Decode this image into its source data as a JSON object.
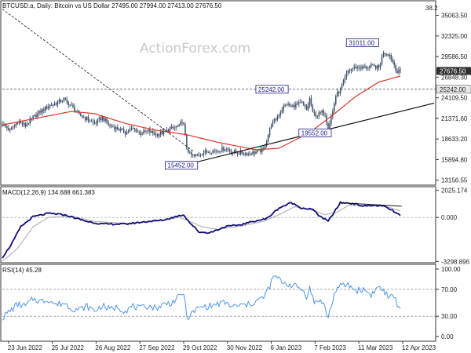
{
  "header": {
    "price_title": "BTCUSD.a, Daily:  Bitcoin vs US Dollar  27495.00  27994.00  27413.00  27676.50",
    "macd_title": "MACD(12,26,9)  134.688 661.383",
    "rsi_title": "RSI(14) 45.28",
    "watermark": "ActionForex.com"
  },
  "colors": {
    "candle": "#3d4f66",
    "ma": "#e0332a",
    "macd": "#0e0e7a",
    "signal": "#b4b4b4",
    "rsi": "#4f95e8",
    "box_border": "#1c1c8a",
    "trend": "#111111"
  },
  "chart_data": [
    {
      "type": "line",
      "name": "price",
      "y_axis_ticks": [
        "35063.50",
        "32325.00",
        "29586.50",
        "26848.30",
        "24109.50",
        "21371.60",
        "18633.20",
        "15894.80",
        "13156.55"
      ],
      "corner_value": "38.2",
      "ylim": [
        12500,
        37000
      ],
      "current_price_label": "27676.50",
      "level_label": "25242.00",
      "level": 25242,
      "x_ticks": [
        "23 Jun 2022",
        "25 Jul 2022",
        "26 Aug 2022",
        "27 Sep 2022",
        "29 Oct 2022",
        "30 Nov 2022",
        "6 Jan 2023",
        "7 Feb 2023",
        "11 Mar 2023",
        "12 Apr 2023"
      ],
      "annotations": [
        {
          "label": "31011.00",
          "index": 248,
          "value": 31011
        },
        {
          "label": "25242.00",
          "index": 185,
          "value": 25242
        },
        {
          "label": "19552.00",
          "index": 212,
          "value": 19552
        },
        {
          "label": "15452.00",
          "index": 124,
          "value": 15452
        }
      ],
      "anchors": [
        [
          0,
          20600
        ],
        [
          5,
          19800
        ],
        [
          10,
          21000
        ],
        [
          15,
          20400
        ],
        [
          20,
          21500
        ],
        [
          25,
          22300
        ],
        [
          30,
          23000
        ],
        [
          35,
          23400
        ],
        [
          40,
          23900
        ],
        [
          45,
          23000
        ],
        [
          50,
          21800
        ],
        [
          55,
          21300
        ],
        [
          60,
          20700
        ],
        [
          65,
          21500
        ],
        [
          70,
          20400
        ],
        [
          75,
          20000
        ],
        [
          80,
          19500
        ],
        [
          85,
          20000
        ],
        [
          90,
          19400
        ],
        [
          95,
          19700
        ],
        [
          100,
          19200
        ],
        [
          105,
          19500
        ],
        [
          110,
          20000
        ],
        [
          115,
          20300
        ],
        [
          117,
          21000
        ],
        [
          118,
          20400
        ],
        [
          120,
          17500
        ],
        [
          122,
          16600
        ],
        [
          125,
          16300
        ],
        [
          130,
          16800
        ],
        [
          135,
          17000
        ],
        [
          140,
          17100
        ],
        [
          145,
          17400
        ],
        [
          150,
          16900
        ],
        [
          155,
          16800
        ],
        [
          160,
          16700
        ],
        [
          165,
          16900
        ],
        [
          170,
          17200
        ],
        [
          172,
          18500
        ],
        [
          175,
          20600
        ],
        [
          178,
          21300
        ],
        [
          182,
          22600
        ],
        [
          185,
          23300
        ],
        [
          188,
          22900
        ],
        [
          190,
          23100
        ],
        [
          195,
          23400
        ],
        [
          198,
          22500
        ],
        [
          200,
          24000
        ],
        [
          202,
          22000
        ],
        [
          205,
          21800
        ],
        [
          208,
          22200
        ],
        [
          210,
          22000
        ],
        [
          212,
          20000
        ],
        [
          213,
          20800
        ],
        [
          215,
          22300
        ],
        [
          217,
          24400
        ],
        [
          220,
          25200
        ],
        [
          225,
          27700
        ],
        [
          230,
          28200
        ],
        [
          235,
          28100
        ],
        [
          240,
          28300
        ],
        [
          245,
          28100
        ],
        [
          248,
          30200
        ],
        [
          252,
          29800
        ],
        [
          255,
          28500
        ],
        [
          257,
          27500
        ],
        [
          259,
          27676
        ]
      ],
      "ma_anchors": [
        [
          0,
          20500
        ],
        [
          25,
          21500
        ],
        [
          45,
          22300
        ],
        [
          60,
          22000
        ],
        [
          80,
          20700
        ],
        [
          100,
          19800
        ],
        [
          120,
          19200
        ],
        [
          140,
          18200
        ],
        [
          165,
          17200
        ],
        [
          180,
          17400
        ],
        [
          200,
          19500
        ],
        [
          215,
          21800
        ],
        [
          230,
          24300
        ],
        [
          245,
          26200
        ],
        [
          259,
          27000
        ]
      ],
      "trend_lines": [
        {
          "from": [
            0,
            35900
          ],
          "to": [
            125,
            16900
          ]
        },
        {
          "from": [
            124,
            15452
          ],
          "to": [
            281,
            23400
          ]
        }
      ],
      "xmax": 282
    },
    {
      "type": "line",
      "name": "MACD(12,26,9)",
      "y_axis_ticks": [
        "2025.174",
        "0.000",
        "-3298.896"
      ],
      "ylim": [
        -3400,
        2300
      ],
      "macd_anchors": [
        [
          0,
          -3000
        ],
        [
          6,
          -2000
        ],
        [
          12,
          -700
        ],
        [
          20,
          50
        ],
        [
          30,
          300
        ],
        [
          40,
          200
        ],
        [
          55,
          -300
        ],
        [
          65,
          -500
        ],
        [
          80,
          -500
        ],
        [
          95,
          -300
        ],
        [
          105,
          -200
        ],
        [
          114,
          100
        ],
        [
          118,
          200
        ],
        [
          122,
          -400
        ],
        [
          128,
          -1100
        ],
        [
          135,
          -1150
        ],
        [
          145,
          -700
        ],
        [
          155,
          -550
        ],
        [
          165,
          -250
        ],
        [
          172,
          -100
        ],
        [
          180,
          700
        ],
        [
          188,
          1100
        ],
        [
          195,
          700
        ],
        [
          202,
          600
        ],
        [
          206,
          150
        ],
        [
          212,
          -300
        ],
        [
          216,
          400
        ],
        [
          220,
          1100
        ],
        [
          228,
          1050
        ],
        [
          235,
          850
        ],
        [
          242,
          900
        ],
        [
          248,
          850
        ],
        [
          254,
          500
        ],
        [
          259,
          130
        ]
      ],
      "signal_anchors": [
        [
          0,
          -3300
        ],
        [
          10,
          -2300
        ],
        [
          20,
          -700
        ],
        [
          30,
          0
        ],
        [
          45,
          100
        ],
        [
          60,
          -300
        ],
        [
          80,
          -450
        ],
        [
          100,
          -300
        ],
        [
          115,
          0
        ],
        [
          120,
          -200
        ],
        [
          130,
          -700
        ],
        [
          140,
          -900
        ],
        [
          155,
          -650
        ],
        [
          170,
          -300
        ],
        [
          180,
          200
        ],
        [
          190,
          800
        ],
        [
          200,
          600
        ],
        [
          210,
          200
        ],
        [
          218,
          400
        ],
        [
          225,
          900
        ],
        [
          240,
          900
        ],
        [
          250,
          800
        ],
        [
          259,
          500
        ]
      ],
      "trend_line": {
        "from": [
          220,
          1100
        ],
        "to": [
          260,
          600
        ]
      }
    },
    {
      "type": "line",
      "name": "RSI(14)",
      "y_axis_ticks": [
        "100.00",
        "70.00",
        "30.00",
        "0.00"
      ],
      "ylim": [
        0,
        100
      ],
      "levels": [
        70,
        30
      ],
      "anchors": [
        [
          0,
          28
        ],
        [
          5,
          38
        ],
        [
          10,
          48
        ],
        [
          15,
          45
        ],
        [
          20,
          56
        ],
        [
          25,
          52
        ],
        [
          30,
          55
        ],
        [
          35,
          47
        ],
        [
          40,
          50
        ],
        [
          45,
          42
        ],
        [
          50,
          40
        ],
        [
          55,
          45
        ],
        [
          60,
          38
        ],
        [
          65,
          46
        ],
        [
          70,
          40
        ],
        [
          75,
          44
        ],
        [
          80,
          38
        ],
        [
          85,
          45
        ],
        [
          90,
          41
        ],
        [
          95,
          46
        ],
        [
          100,
          42
        ],
        [
          105,
          48
        ],
        [
          110,
          50
        ],
        [
          115,
          58
        ],
        [
          118,
          66
        ],
        [
          120,
          28
        ],
        [
          123,
          33
        ],
        [
          126,
          40
        ],
        [
          130,
          44
        ],
        [
          135,
          45
        ],
        [
          140,
          48
        ],
        [
          145,
          50
        ],
        [
          150,
          44
        ],
        [
          155,
          46
        ],
        [
          160,
          47
        ],
        [
          165,
          52
        ],
        [
          170,
          58
        ],
        [
          173,
          70
        ],
        [
          177,
          90
        ],
        [
          181,
          83
        ],
        [
          185,
          78
        ],
        [
          190,
          75
        ],
        [
          195,
          70
        ],
        [
          198,
          60
        ],
        [
          200,
          72
        ],
        [
          203,
          50
        ],
        [
          206,
          55
        ],
        [
          209,
          48
        ],
        [
          212,
          28
        ],
        [
          214,
          45
        ],
        [
          217,
          70
        ],
        [
          221,
          75
        ],
        [
          225,
          77
        ],
        [
          230,
          68
        ],
        [
          235,
          70
        ],
        [
          240,
          62
        ],
        [
          245,
          74
        ],
        [
          248,
          68
        ],
        [
          252,
          56
        ],
        [
          255,
          62
        ],
        [
          257,
          45
        ],
        [
          259,
          45
        ]
      ]
    }
  ]
}
